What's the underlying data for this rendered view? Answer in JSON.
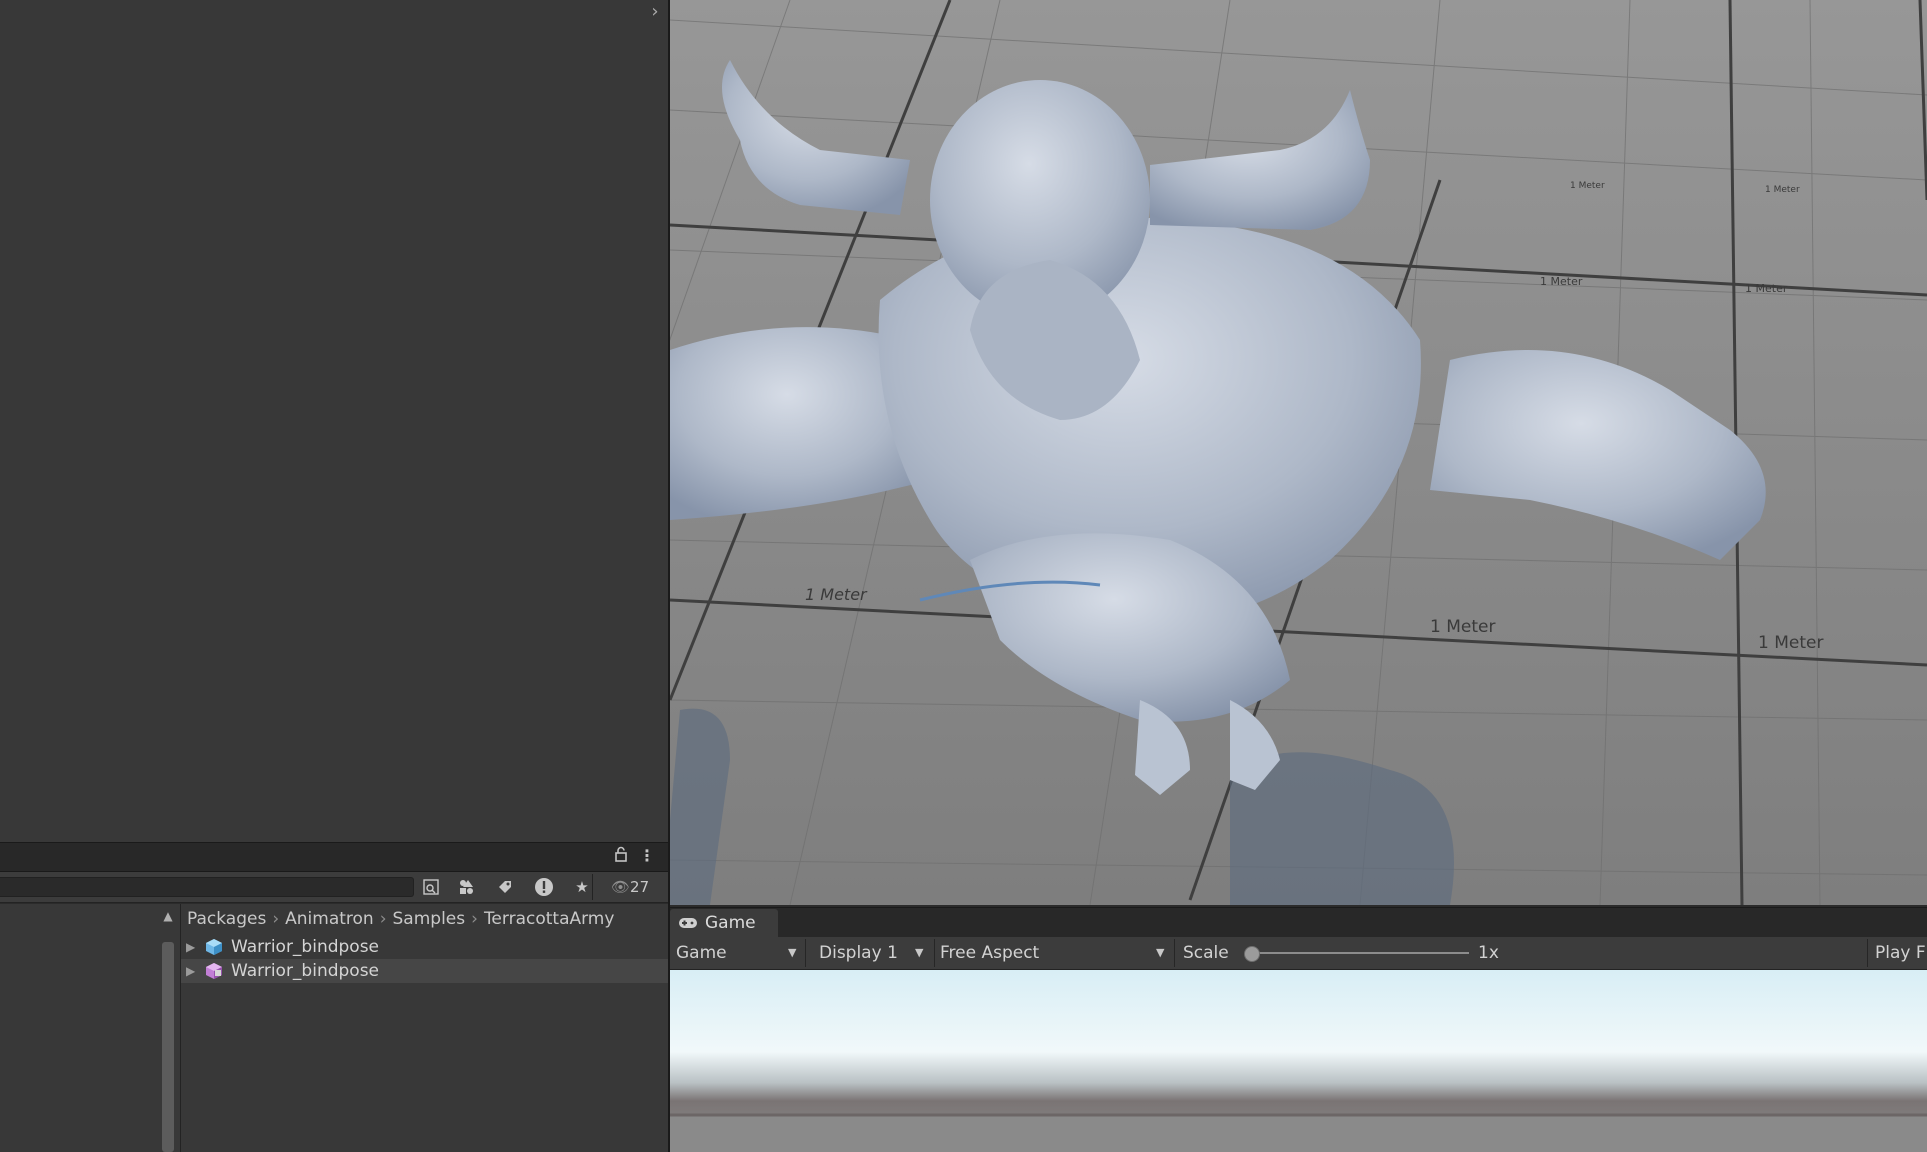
{
  "project_panel": {
    "search_value": "",
    "visibility_count": "27",
    "breadcrumb": [
      "Packages",
      "Animatron",
      "Samples",
      "TerracottaArmy"
    ],
    "files": [
      {
        "label": "Warrior_bindpose",
        "icon": "prefab-icon",
        "selected": false
      },
      {
        "label": "Warrior_bindpose",
        "icon": "model-prefab-icon",
        "selected": true
      }
    ]
  },
  "scene": {
    "grid_labels": [
      "1 Meter",
      "1 Meter",
      "1 Meter",
      "1 Meter",
      "1 Meter",
      "1 Meter",
      "1 Meter"
    ]
  },
  "game": {
    "tab_label": "Game",
    "view_mode": "Game",
    "display": "Display 1",
    "aspect": "Free Aspect",
    "scale_label": "Scale",
    "scale_value": "1x",
    "play_focused": "Play F"
  },
  "colors": {
    "panel_bg": "#383838",
    "toolbar_bg": "#3c3c3c",
    "selection": "#464646",
    "floor": "#8a8a8a",
    "sky_top": "#e8f3f7"
  }
}
